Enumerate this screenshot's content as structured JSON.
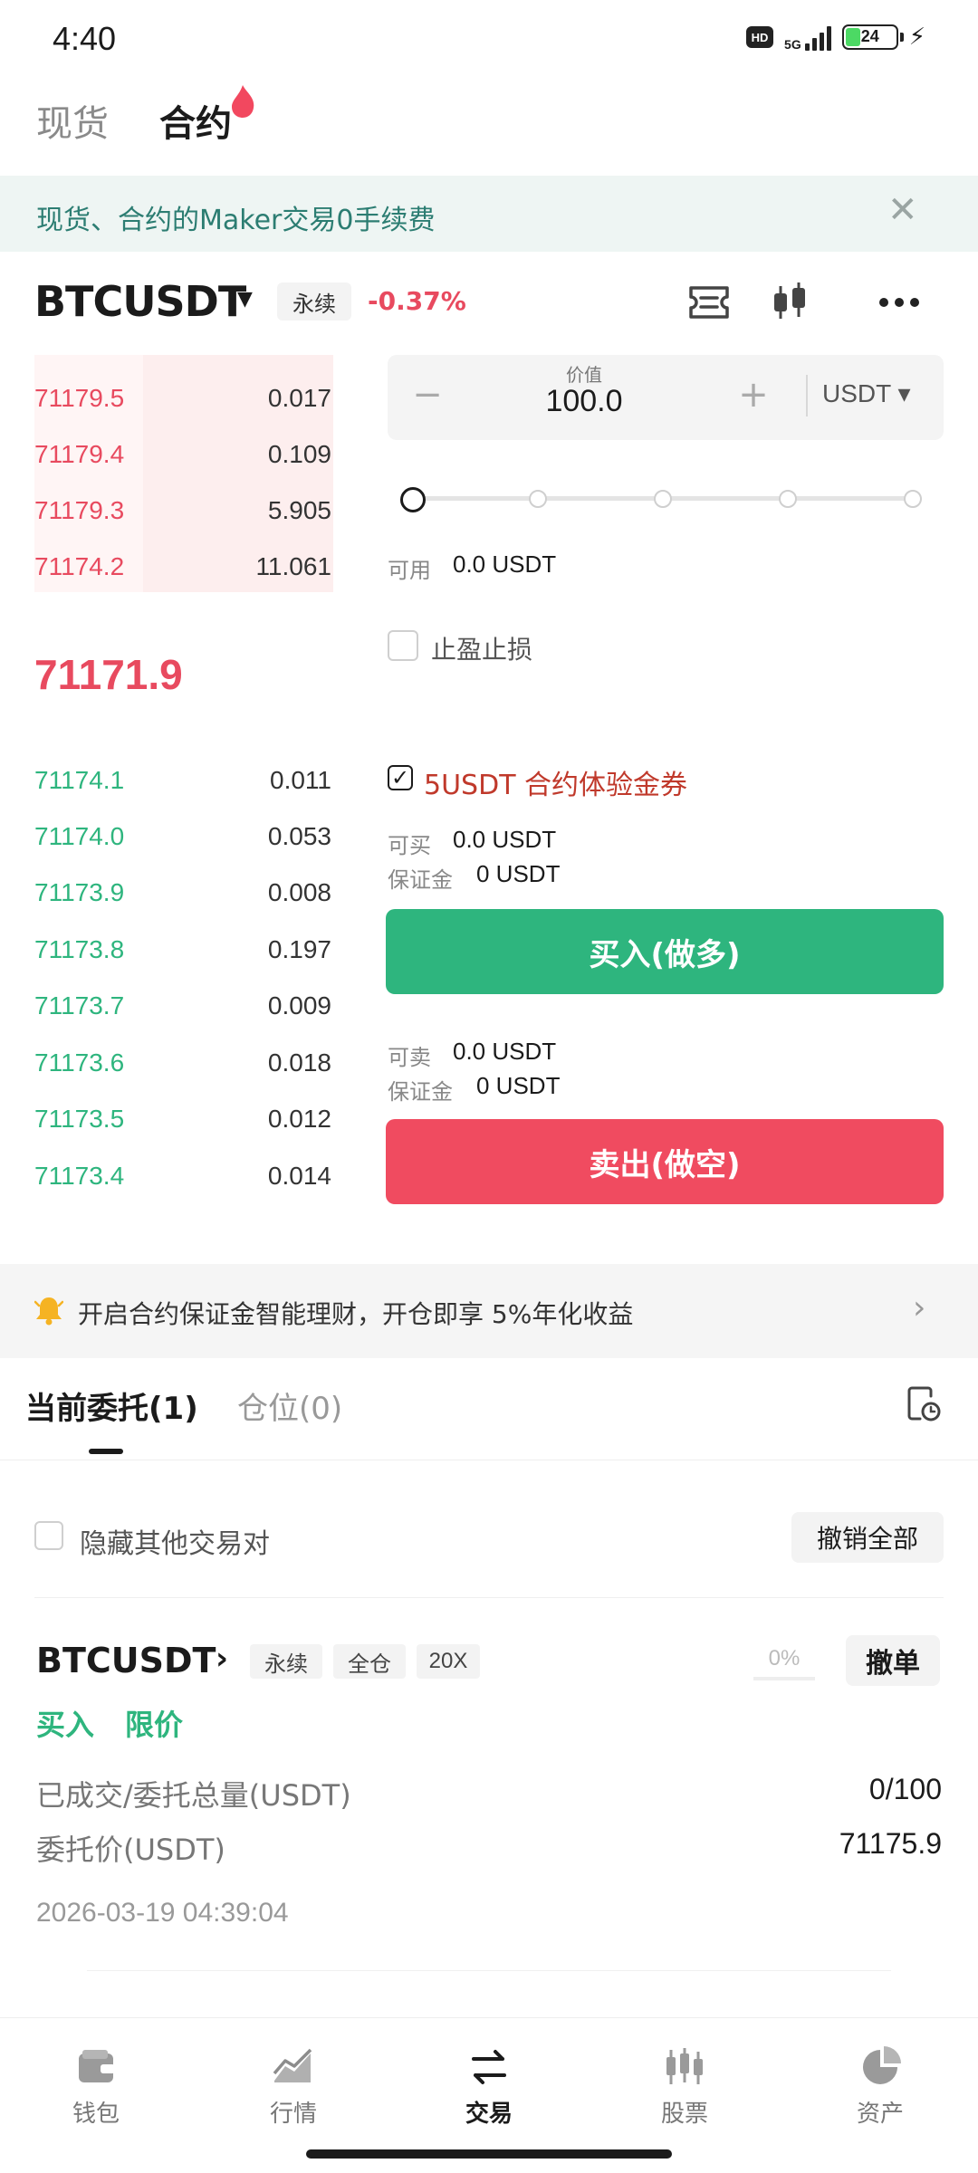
{
  "status_bar": {
    "time": "4:40",
    "hd": "HD",
    "network": "5G",
    "battery": "24"
  },
  "top_tabs": {
    "spot": "现货",
    "contract": "合约"
  },
  "promo": {
    "text": "现货、合约的Maker交易0手续费",
    "close": "✕"
  },
  "symbol": {
    "name": "BTCUSDT",
    "type": "永续",
    "change": "-0.37%"
  },
  "order_book": {
    "asks": [
      {
        "price": "71179.5",
        "qty": "0.017"
      },
      {
        "price": "71179.4",
        "qty": "0.109"
      },
      {
        "price": "71179.3",
        "qty": "5.905"
      },
      {
        "price": "71174.2",
        "qty": "11.061"
      }
    ],
    "last_price": "71171.9",
    "bids": [
      {
        "price": "71174.1",
        "qty": "0.011"
      },
      {
        "price": "71174.0",
        "qty": "0.053"
      },
      {
        "price": "71173.9",
        "qty": "0.008"
      },
      {
        "price": "71173.8",
        "qty": "0.197"
      },
      {
        "price": "71173.7",
        "qty": "0.009"
      },
      {
        "price": "71173.6",
        "qty": "0.018"
      },
      {
        "price": "71173.5",
        "qty": "0.012"
      },
      {
        "price": "71173.4",
        "qty": "0.014"
      }
    ]
  },
  "form": {
    "minus": "−",
    "plus": "+",
    "value_label": "价值",
    "value": "100.0",
    "unit": "USDT ▾",
    "slider_percent": 0,
    "available_label": "可用",
    "available_value": "0.0 USDT",
    "tpsl_label": "止盈止损",
    "coupon_label": "5USDT 合约体验金券",
    "can_buy_label": "可买",
    "can_buy_value": "0.0 USDT",
    "margin_label": "保证金",
    "buy_margin_value": "0 USDT",
    "buy_button": "买入(做多)",
    "can_sell_label": "可卖",
    "can_sell_value": "0.0 USDT",
    "sell_margin_value": "0 USDT",
    "sell_button": "卖出(做空)"
  },
  "notice": {
    "text": "开启合约保证金智能理财，开仓即享 5%年化收益",
    "chevron": "›"
  },
  "orders": {
    "tab_open": "当前委托(1)",
    "tab_positions": "仓位(0)",
    "hide_others": "隐藏其他交易对",
    "cancel_all": "撤销全部",
    "item": {
      "symbol": "BTCUSDT",
      "chevron": "›",
      "tag_perp": "永续",
      "tag_cross": "全仓",
      "tag_leverage": "20X",
      "progress": "0%",
      "cancel": "撤单",
      "side": "买入",
      "type": "限价",
      "filled_label": "已成交/委托总量(USDT)",
      "filled_value": "0/100",
      "price_label": "委托价(USDT)",
      "price_value": "71175.9",
      "time": "2026-03-19 04:39:04"
    }
  },
  "nav": {
    "wallet": "钱包",
    "market": "行情",
    "trade": "交易",
    "stocks": "股票",
    "assets": "资产"
  },
  "colors": {
    "up": "#2eb57e",
    "down": "#e84a5f",
    "accent_sell_btn": "#f04b60"
  }
}
